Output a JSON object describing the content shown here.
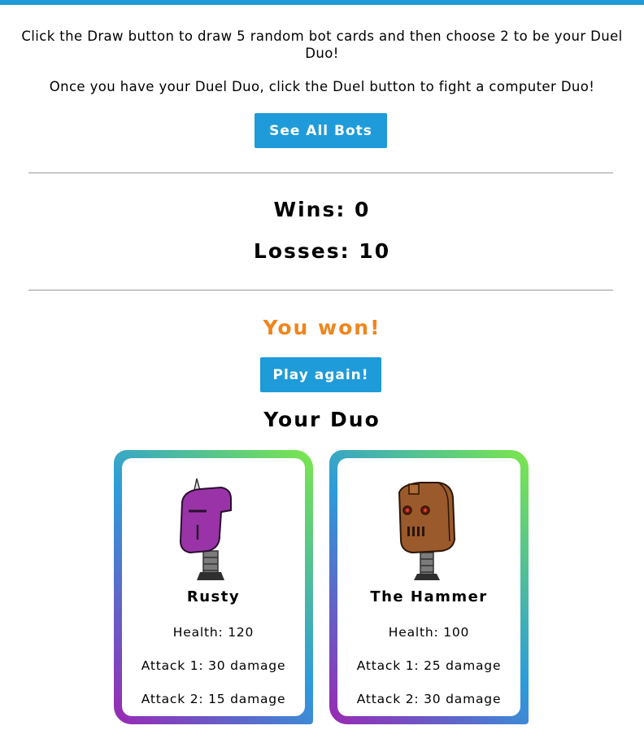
{
  "intro": {
    "line1": "Click the Draw button to draw 5 random bot cards and then choose 2 to be your Duel Duo!",
    "line2": "Once you have your Duel Duo, click the Duel button to fight a computer Duo!"
  },
  "buttons": {
    "see_all": "See All Bots",
    "play_again": "Play again!"
  },
  "stats": {
    "wins": "Wins: 0",
    "losses": "Losses: 10"
  },
  "result_text": "You won!",
  "duo_title": "Your Duo",
  "cards": [
    {
      "name": "Rusty",
      "health": "Health: 120",
      "attack1": "Attack 1: 30 damage",
      "attack2": "Attack 2: 15 damage",
      "image_icon": "purple-robot-head-icon"
    },
    {
      "name": "The Hammer",
      "health": "Health: 100",
      "attack1": "Attack 1: 25 damage",
      "attack2": "Attack 2: 30 damage",
      "image_icon": "brown-robot-head-icon"
    }
  ],
  "colors": {
    "accent": "#1f9bd9",
    "result": "#f0851c",
    "card_gradient": [
      "#9b27b3",
      "#2d9bdb",
      "#7be84a"
    ]
  }
}
